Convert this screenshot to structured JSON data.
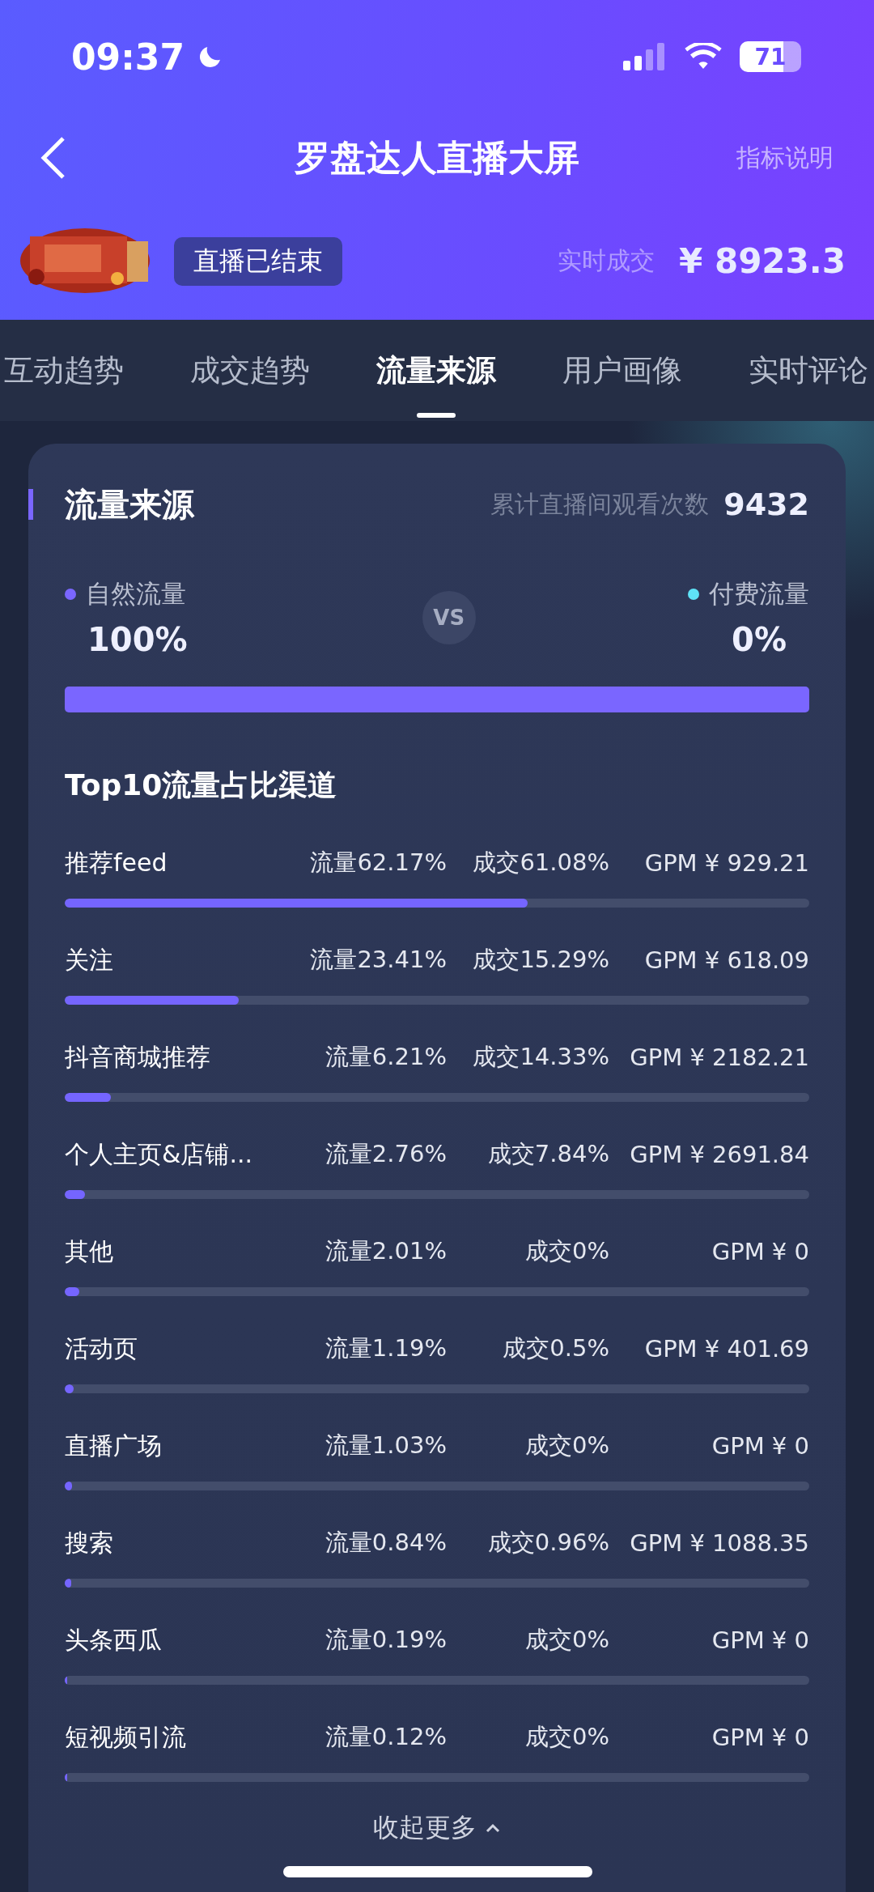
{
  "status_bar": {
    "time": "09:37",
    "battery": "71"
  },
  "nav": {
    "title": "罗盘达人直播大屏",
    "action": "指标说明"
  },
  "live": {
    "status": "直播已结束",
    "sales_label": "实时成交",
    "sales_value": "¥ 8923.3"
  },
  "tabs": [
    {
      "label": "互动趋势",
      "selected": false
    },
    {
      "label": "成交趋势",
      "selected": false
    },
    {
      "label": "流量来源",
      "selected": true
    },
    {
      "label": "用户画像",
      "selected": false
    },
    {
      "label": "实时评论",
      "selected": false
    }
  ],
  "section": {
    "title": "流量来源",
    "views_label": "累计直播间观看次数",
    "views_value": "9432"
  },
  "split": {
    "vs": "VS",
    "natural": {
      "label": "自然流量",
      "value": "100%",
      "color": "#7a66ff",
      "level": 1
    },
    "paid": {
      "label": "付费流量",
      "value": "0%",
      "color": "#5fe3f7"
    }
  },
  "top10": {
    "title": "Top10流量占比渠道",
    "channels": [
      {
        "name": "推荐feed",
        "flow": "流量62.17%",
        "deal": "成交61.08%",
        "gpm": "GPM ¥ 929.21",
        "level": 0.6217
      },
      {
        "name": "关注",
        "flow": "流量23.41%",
        "deal": "成交15.29%",
        "gpm": "GPM ¥ 618.09",
        "level": 0.2341
      },
      {
        "name": "抖音商城推荐",
        "flow": "流量6.21%",
        "deal": "成交14.33%",
        "gpm": "GPM ¥ 2182.21",
        "level": 0.0621
      },
      {
        "name": "个人主页&店铺...",
        "flow": "流量2.76%",
        "deal": "成交7.84%",
        "gpm": "GPM ¥ 2691.84",
        "level": 0.0276
      },
      {
        "name": "其他",
        "flow": "流量2.01%",
        "deal": "成交0%",
        "gpm": "GPM ¥ 0",
        "level": 0.0201
      },
      {
        "name": "活动页",
        "flow": "流量1.19%",
        "deal": "成交0.5%",
        "gpm": "GPM ¥ 401.69",
        "level": 0.0119
      },
      {
        "name": "直播广场",
        "flow": "流量1.03%",
        "deal": "成交0%",
        "gpm": "GPM ¥ 0",
        "level": 0.0103
      },
      {
        "name": "搜索",
        "flow": "流量0.84%",
        "deal": "成交0.96%",
        "gpm": "GPM ¥ 1088.35",
        "level": 0.0084
      },
      {
        "name": "头条西瓜",
        "flow": "流量0.19%",
        "deal": "成交0%",
        "gpm": "GPM ¥ 0",
        "level": 0.0019
      },
      {
        "name": "短视频引流",
        "flow": "流量0.12%",
        "deal": "成交0%",
        "gpm": "GPM ¥ 0",
        "level": 0.0012
      }
    ],
    "collapse": "收起更多"
  }
}
